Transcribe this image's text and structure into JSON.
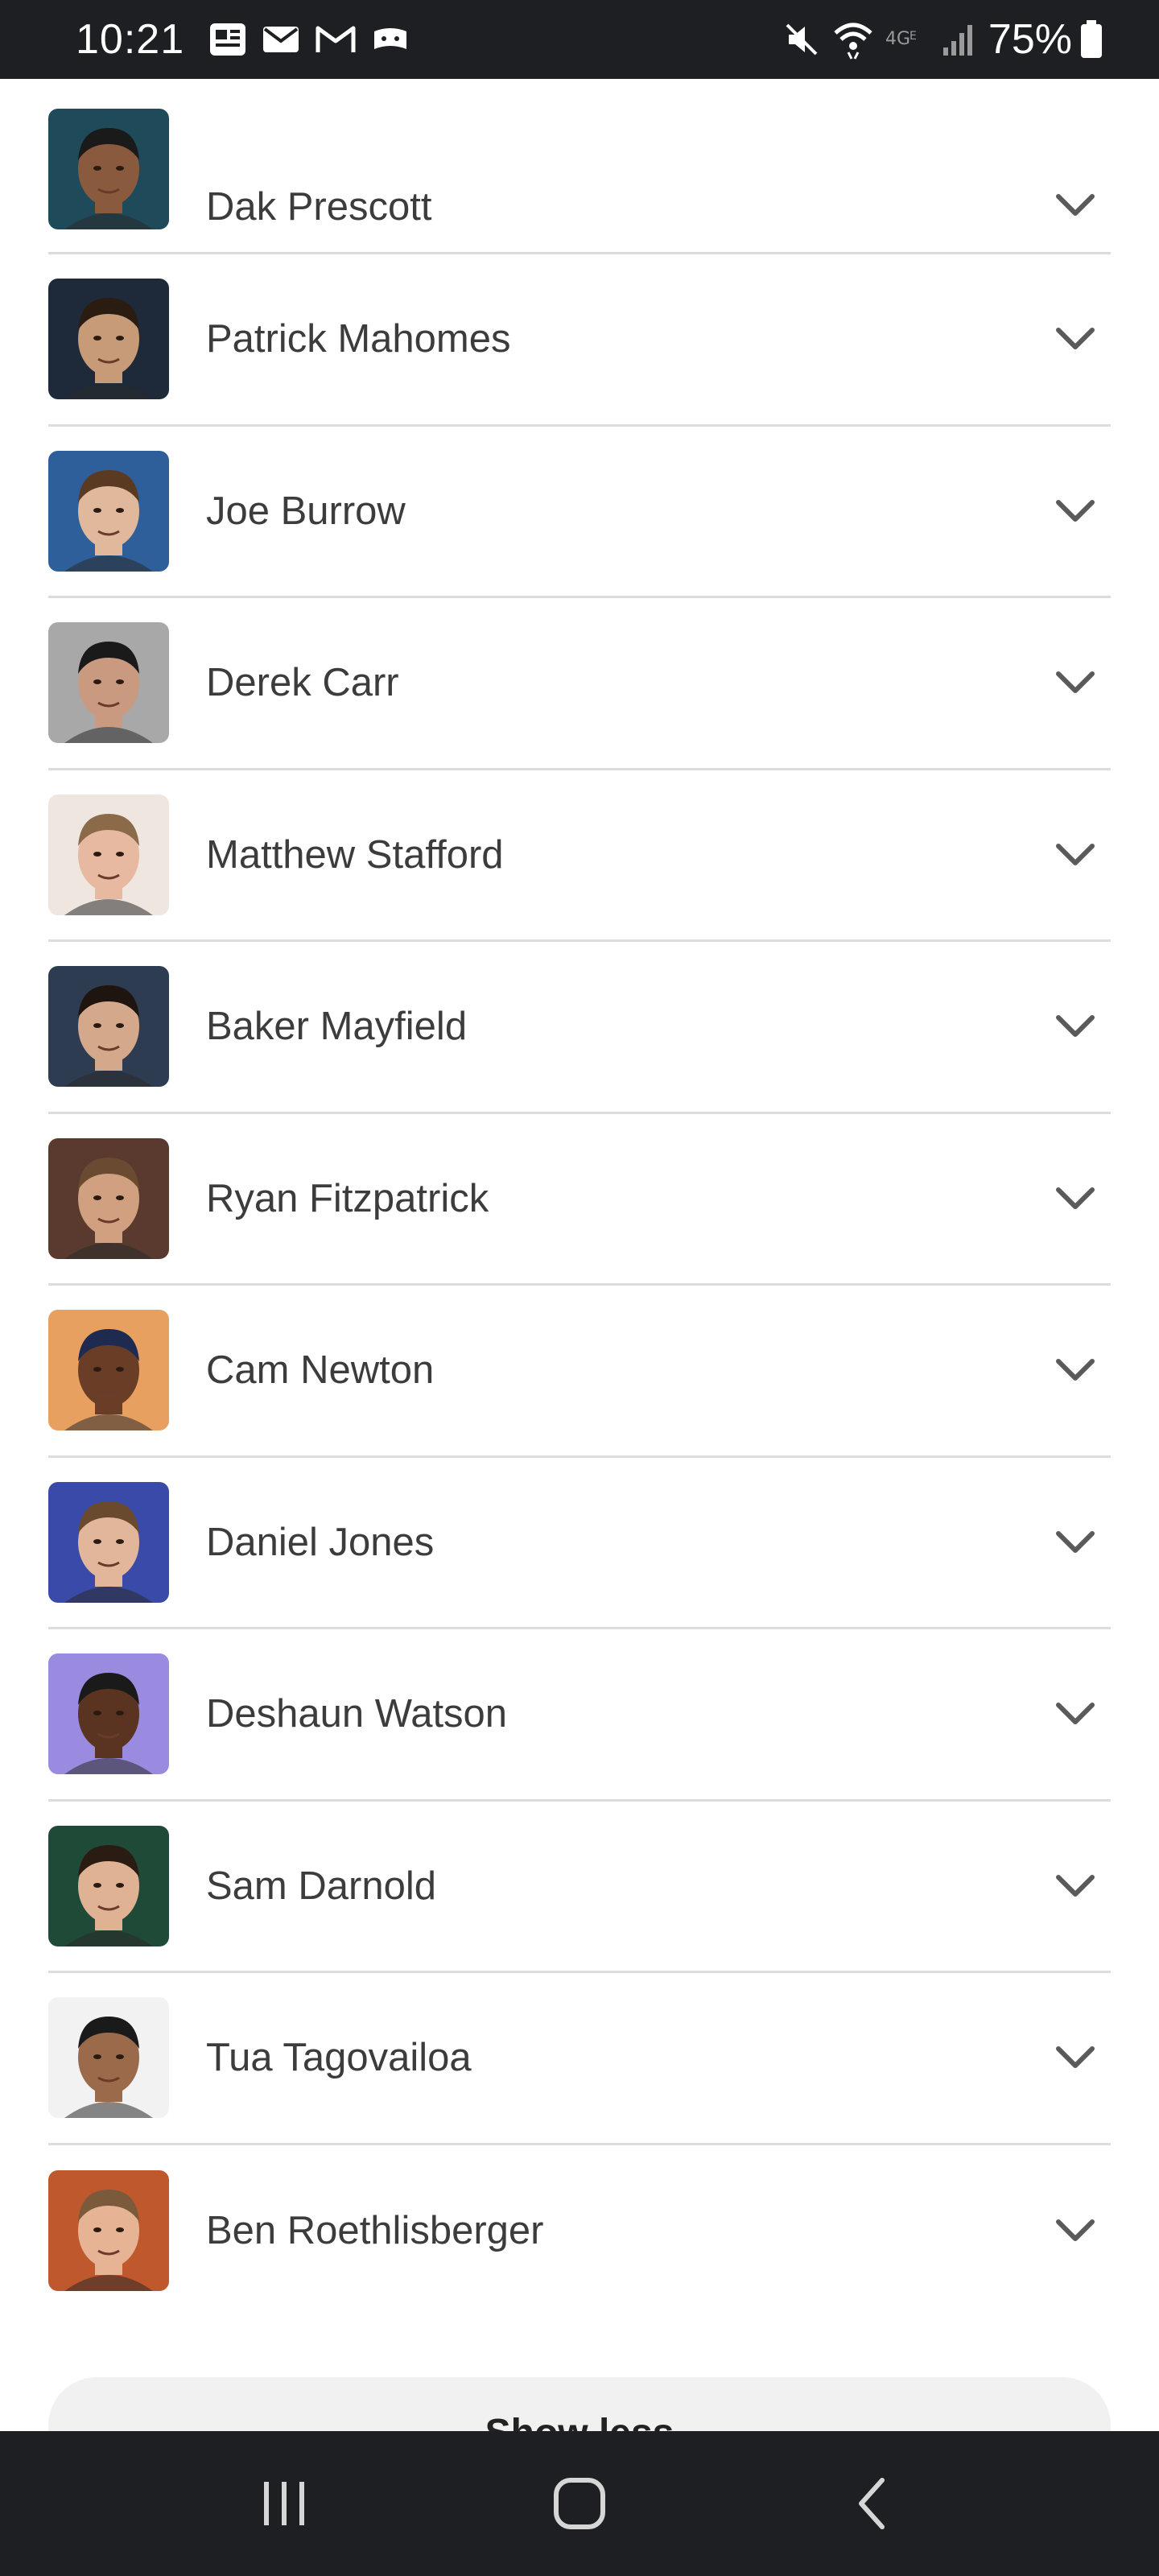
{
  "status_bar": {
    "time": "10:21",
    "battery": "75%",
    "left_icons": [
      "news-icon",
      "message-icon",
      "gmail-icon",
      "game-icon"
    ],
    "right_icons": [
      "mute-icon",
      "wifi-icon",
      "lte-icon",
      "signal-icon",
      "battery-icon"
    ]
  },
  "players": [
    {
      "name": "Dak Prescott",
      "avatar_bg": "#1f4a5a",
      "skin": "#8a5a3e",
      "hair": "#1a1a1a"
    },
    {
      "name": "Patrick Mahomes",
      "avatar_bg": "#1e2a3a",
      "skin": "#c79a78",
      "hair": "#2b1c12"
    },
    {
      "name": "Joe Burrow",
      "avatar_bg": "#2f5f9a",
      "skin": "#e0b89c",
      "hair": "#5a3b22"
    },
    {
      "name": "Derek Carr",
      "avatar_bg": "#a8a8a8",
      "skin": "#c99a80",
      "hair": "#1a1a1a"
    },
    {
      "name": "Matthew Stafford",
      "avatar_bg": "#f0e6e0",
      "skin": "#e6b9a0",
      "hair": "#8a6a48"
    },
    {
      "name": "Baker Mayfield",
      "avatar_bg": "#2e3c52",
      "skin": "#d4a88a",
      "hair": "#1e1410"
    },
    {
      "name": "Ryan Fitzpatrick",
      "avatar_bg": "#5a3a2e",
      "skin": "#d0a080",
      "hair": "#6a4a30"
    },
    {
      "name": "Cam Newton",
      "avatar_bg": "#e8a060",
      "skin": "#6a3e26",
      "hair": "#1e2a50"
    },
    {
      "name": "Daniel Jones",
      "avatar_bg": "#3a4aa8",
      "skin": "#e2b69a",
      "hair": "#6a4a2e"
    },
    {
      "name": "Deshaun Watson",
      "avatar_bg": "#9a8ae0",
      "skin": "#5a3420",
      "hair": "#1a1a1a"
    },
    {
      "name": "Sam Darnold",
      "avatar_bg": "#1f4a38",
      "skin": "#e0b294",
      "hair": "#2a1c12"
    },
    {
      "name": "Tua Tagovailoa",
      "avatar_bg": "#f2f2f2",
      "skin": "#9a6a4a",
      "hair": "#1a1a1a"
    },
    {
      "name": "Ben Roethlisberger",
      "avatar_bg": "#c0582e",
      "skin": "#e6b494",
      "hair": "#7a5a3a"
    }
  ],
  "show_more": {
    "label": "Show less"
  },
  "nav_bar": {
    "buttons": [
      "recents-icon",
      "home-icon",
      "back-icon"
    ]
  }
}
